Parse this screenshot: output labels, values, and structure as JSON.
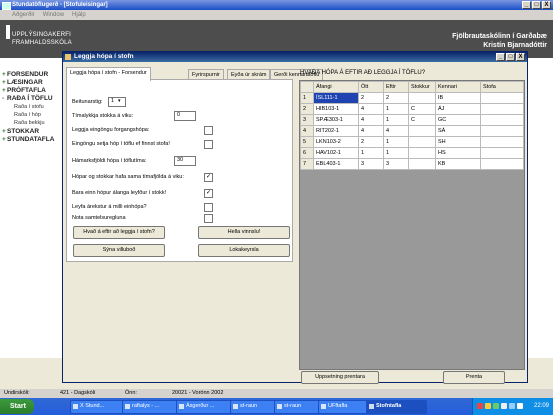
{
  "window": {
    "title": "Stundatöflugerð - [Stofuleisingar]",
    "buttons": [
      "_",
      "□",
      "X"
    ]
  },
  "menubar": [
    "Aðgerðir",
    "Window",
    "Hjálp"
  ],
  "banner": {
    "logo_line1": "UPPLÝSINGAKERFI",
    "logo_line2": "FRAMHALDSSKÓLA",
    "school": "Fjölbrautaskólinn í Garðabæ",
    "student": "Kristín Bjarnadóttir"
  },
  "leftnav": {
    "items": [
      {
        "sign": "+",
        "label": "FORSENDUR"
      },
      {
        "sign": "+",
        "label": "LÆSINGAR"
      },
      {
        "sign": "+",
        "label": "PRÓFTAFLA"
      },
      {
        "sign": "-",
        "label": "RAÐA Í TÖFLU"
      }
    ],
    "subitems": [
      "Raða í stofu",
      "Raða í hóp",
      "Raða bekkju"
    ],
    "items2": [
      {
        "sign": "+",
        "label": "STOKKAR"
      },
      {
        "sign": "+",
        "label": "STUNDATAFLA"
      }
    ]
  },
  "dialog": {
    "title": "Leggja hópa í stofn",
    "buttons": [
      "_",
      "□",
      "X"
    ],
    "tabs": [
      "Leggja hópa í stofn - Forsendur",
      "Fyrirspurnir",
      "Eyða úr skrám",
      "Gerði kennaratöflu"
    ],
    "form": {
      "level_label": "Beitunarstig:",
      "level_value": "1",
      "block_label": "Tímalykkja stokka á viku:",
      "block_value": "0",
      "priority_label": "Leggja eingöngu forgangshópa:",
      "empty_only_label": "Eingöngu setja hóp í töflu ef finnst stofa!",
      "max_groups_label": "Hámarksfjöldi hópa í töflutíma:",
      "max_groups_value": "30",
      "same_slot_label": "Hópar og stokkar hafa sama tímafjölda á viku:",
      "same_slot_checked": "✓",
      "one_group_label": "Bara einn hópur álanga leyfður í stokk!",
      "one_group_checked": "✓",
      "allow_label": "Leyfa árekstur á milli einhópa?",
      "group_rule_label": "Nota samtelsuregluna"
    },
    "actions": {
      "what_to_place": "Hvað á eftir að leggja í stofn?",
      "empty_container": "Hella vinnslu!",
      "show_results": "Sýna villuboð",
      "close_report": "Lokakeyrsla"
    },
    "grid": {
      "heading": "HVAÐA HÓPA Á EFTIR AÐ LEGGJA Í TÖFLU?",
      "columns": [
        "Áfangi",
        "Ött",
        "Eftir",
        "Stokkur",
        "Kennari",
        "Stofa"
      ],
      "rows": [
        {
          "n": "1",
          "cells": [
            "ÍSL111-1",
            "2",
            "2",
            "",
            "IB",
            ""
          ]
        },
        {
          "n": "2",
          "cells": [
            "HIB103-1",
            "4",
            "1",
            "C",
            "ÁJ",
            ""
          ]
        },
        {
          "n": "3",
          "cells": [
            "SPÆ303-1",
            "4",
            "1",
            "C",
            "GC",
            ""
          ]
        },
        {
          "n": "4",
          "cells": [
            "RIT202-1",
            "4",
            "4",
            "",
            "SÁ",
            ""
          ]
        },
        {
          "n": "5",
          "cells": [
            "LKN103-2",
            "2",
            "1",
            "",
            "SH",
            ""
          ]
        },
        {
          "n": "6",
          "cells": [
            "HAV102-1",
            "1",
            "1",
            "",
            "HS",
            ""
          ]
        },
        {
          "n": "7",
          "cells": [
            "EBL403-1",
            "3",
            "3",
            "",
            "KB",
            ""
          ]
        }
      ],
      "update_button": "Uppsetning prentara",
      "print_button": "Prenta"
    }
  },
  "statusbar": {
    "left": "Undirskóli:",
    "center1": "421 - Dagskóli",
    "center2": "Önn:",
    "center3": "20021 - Vorönn 2002"
  },
  "taskbar": {
    "start": "Start",
    "tasks": [
      "X Stund...",
      "raftalys - ...",
      "Ásgerður ...",
      "st-raun",
      "st-raun",
      "UFftafla",
      "Stofntafla"
    ],
    "clock": "22:09"
  }
}
